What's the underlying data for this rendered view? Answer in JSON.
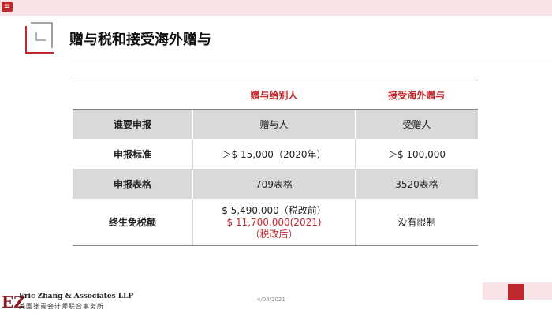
{
  "header": {
    "menu_glyph": "≡"
  },
  "title": "赠与税和接受海外赠与",
  "table": {
    "columns": [
      "",
      "赠与给别人",
      "接受海外赠与"
    ],
    "rows": [
      {
        "label": "谁要申报",
        "c1": "赠与人",
        "c2": "受赠人"
      },
      {
        "label": "申报标准",
        "c1": "＞$ 15,000（2020年）",
        "c2": "＞$ 100,000"
      },
      {
        "label": "申报表格",
        "c1": "709表格",
        "c2": "3520表格"
      },
      {
        "label": "终生免税额",
        "c1_line1": "$ 5,490,000（税改前）",
        "c1_line2": "$ 11,700,000(2021)",
        "c1_line3": "（税改后）",
        "c2": "没有限制"
      }
    ]
  },
  "footer": {
    "logo_mark": "EZ",
    "logo_name": "Eric Zhang & Associates LLP",
    "logo_sub": "美国张青会计师联合事务所",
    "date": "4/04/2021"
  },
  "colors": {
    "accent": "#c0282d",
    "light_band": "#f8e4e6",
    "row_shade": "#d9d9d9"
  }
}
